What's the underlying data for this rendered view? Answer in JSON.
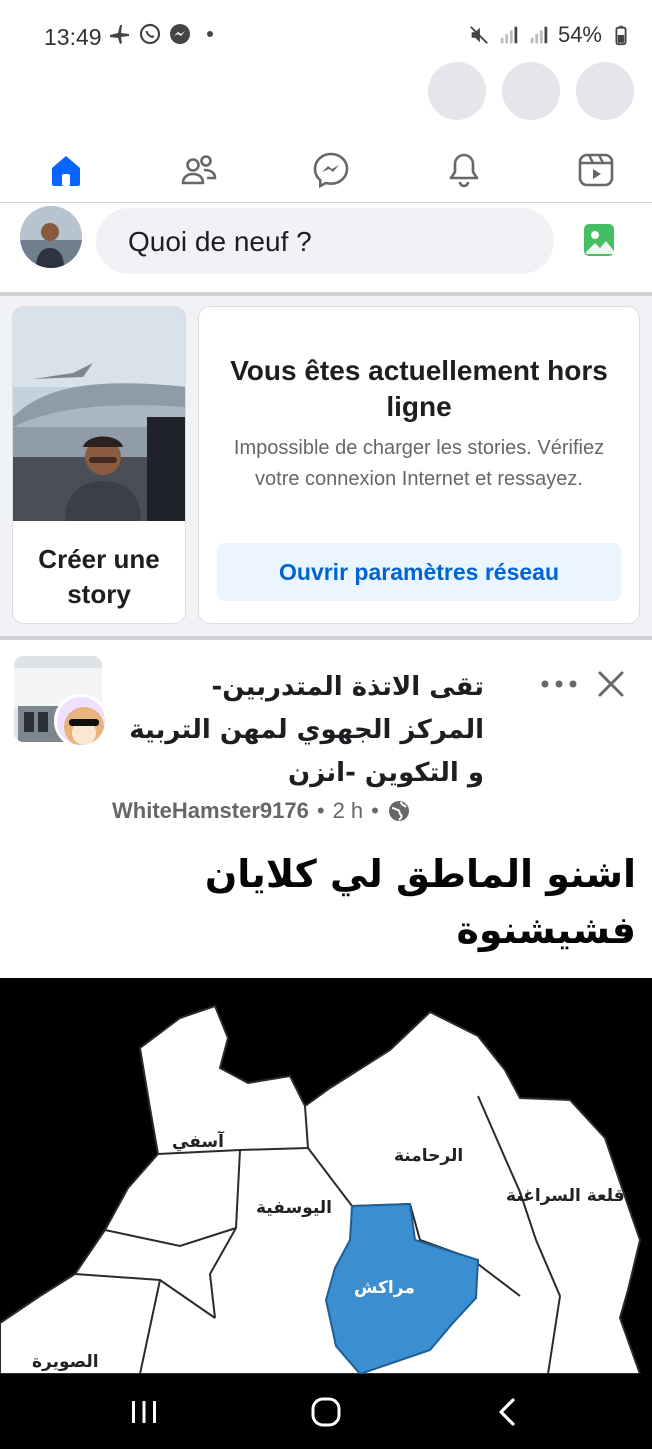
{
  "status_bar": {
    "time": "13:49",
    "battery": "54%",
    "icons": [
      "airplane-icon",
      "whatsapp-icon",
      "messenger-icon",
      "dot-icon",
      "mute-icon",
      "signal-icon",
      "signal-icon",
      "battery-icon"
    ]
  },
  "nav": {
    "items": [
      {
        "name": "home",
        "icon": "home-icon",
        "active": true
      },
      {
        "name": "friends",
        "icon": "friends-icon"
      },
      {
        "name": "messenger",
        "icon": "messenger-icon"
      },
      {
        "name": "notifications",
        "icon": "bell-icon"
      },
      {
        "name": "video",
        "icon": "video-icon"
      }
    ],
    "accent_color": "#0866ff"
  },
  "composer": {
    "placeholder": "Quoi de neuf ?"
  },
  "stories": {
    "create_label": "Créer une story",
    "offline_title": "Vous êtes actuellement hors ligne",
    "offline_message": "Impossible de charger les stories. Vérifiez votre connexion Internet et ressayez.",
    "offline_button": "Ouvrir paramètres réseau"
  },
  "post": {
    "group_name": "تقى الاتذة المتدربين- المركز الجهوي لمهن التربية و التكوين -انزن",
    "author": "WhiteHamster9176",
    "time": "2 h",
    "separator": "•",
    "visibility_icon": "globe-icon",
    "text": "اشنو الماطق لي كلايان فشيشنوة",
    "map_labels": {
      "safi": "آسفي",
      "rehamna": "الرحامنة",
      "kelaa": "قلعة السراغنة",
      "youssoufia": "اليوسفية",
      "marrakech": "مراكش",
      "essaouira": "الصويرة"
    },
    "highlight_color": "#3b8ed0"
  }
}
